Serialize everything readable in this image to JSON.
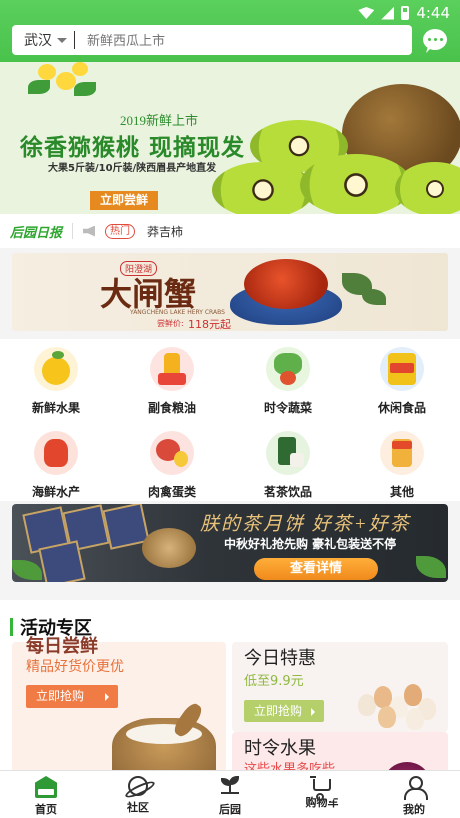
{
  "status_bar": {
    "time": "4:44"
  },
  "header": {
    "city": "武汉",
    "search_placeholder": "新鲜西瓜上市"
  },
  "hero": {
    "subtitle": "2019新鲜上市",
    "title": "徐香猕猴桃  现摘现发",
    "description": "大果5斤装/10斤装/陕西眉县产地直发",
    "button": "立即尝鲜"
  },
  "news": {
    "logo": "后园日报",
    "tag": "热门",
    "headline": "莽吉柿"
  },
  "crab_banner": {
    "seal": "阳澄湖",
    "title": "大闸蟹",
    "subtitle": "YANGCHENG LAKE HERY CRABS",
    "price_label": "尝鲜价:",
    "price": "118元起"
  },
  "categories": [
    {
      "label": "新鲜水果",
      "icon": "fruit-icon"
    },
    {
      "label": "副食粮油",
      "icon": "grain-oil-icon"
    },
    {
      "label": "时令蔬菜",
      "icon": "vegetable-icon"
    },
    {
      "label": "休闲食品",
      "icon": "snack-icon"
    },
    {
      "label": "海鲜水产",
      "icon": "seafood-icon"
    },
    {
      "label": "肉禽蛋类",
      "icon": "meat-egg-icon"
    },
    {
      "label": "茗茶饮品",
      "icon": "tea-icon"
    },
    {
      "label": "其他",
      "icon": "other-icon"
    }
  ],
  "tea_banner": {
    "title": "朕的茶月饼  好茶+好茶",
    "subtitle": "中秋好礼抢先购  豪礼包装送不停",
    "button": "查看详情"
  },
  "promo": {
    "section_title": "活动专区",
    "left_card": {
      "title": "每日尝鲜",
      "subtitle": "精品好货价更优",
      "button": "立即抢购"
    },
    "right_top_card": {
      "title": "今日特惠",
      "subtitle": "低至9.9元",
      "button": "立即抢购"
    },
    "right_bottom_card": {
      "title": "时令水果",
      "subtitle": "这些水果多吃些"
    }
  },
  "tabbar": [
    {
      "label": "首页",
      "icon": "home-icon",
      "active": true
    },
    {
      "label": "社区",
      "icon": "planet-icon",
      "active": false
    },
    {
      "label": "后园",
      "icon": "sprout-icon",
      "active": false
    },
    {
      "label": "购物车",
      "icon": "cart-icon",
      "active": false
    },
    {
      "label": "我的",
      "icon": "user-icon",
      "active": false
    }
  ],
  "colors": {
    "brand_green": "#49c24c",
    "accent_orange": "#f07b45"
  }
}
